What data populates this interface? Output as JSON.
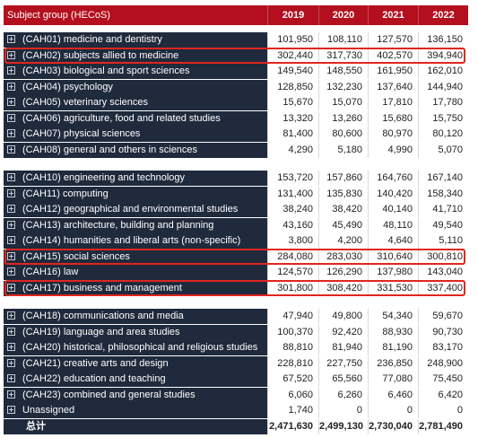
{
  "header": {
    "label": "Subject group (HECoS)",
    "years": [
      "2019",
      "2020",
      "2021",
      "2022"
    ]
  },
  "groups": [
    [
      {
        "label": "(CAH01) medicine and dentistry",
        "values": [
          "101,950",
          "108,110",
          "127,570",
          "136,150"
        ]
      },
      {
        "label": "(CAH02) subjects allied to medicine",
        "values": [
          "302,440",
          "317,730",
          "402,570",
          "394,940"
        ]
      },
      {
        "label": "(CAH03) biological and sport sciences",
        "values": [
          "149,540",
          "148,550",
          "161,950",
          "162,010"
        ]
      },
      {
        "label": "(CAH04) psychology",
        "values": [
          "128,850",
          "132,230",
          "137,640",
          "144,940"
        ]
      },
      {
        "label": "(CAH05) veterinary sciences",
        "values": [
          "15,670",
          "15,070",
          "17,810",
          "17,780"
        ]
      },
      {
        "label": "(CAH06) agriculture, food and related studies",
        "values": [
          "13,320",
          "13,260",
          "15,680",
          "15,750"
        ]
      },
      {
        "label": "(CAH07) physical sciences",
        "values": [
          "81,400",
          "80,600",
          "80,970",
          "80,120"
        ]
      },
      {
        "label": "(CAH08) general and others in sciences",
        "values": [
          "4,290",
          "5,180",
          "4,990",
          "5,070"
        ]
      }
    ],
    [
      {
        "label": "(CAH10) engineering and technology",
        "values": [
          "153,720",
          "157,860",
          "164,760",
          "167,140"
        ]
      },
      {
        "label": "(CAH11) computing",
        "values": [
          "131,400",
          "135,830",
          "140,420",
          "158,340"
        ]
      },
      {
        "label": "(CAH12) geographical and environmental studies",
        "values": [
          "38,240",
          "38,420",
          "40,140",
          "41,710"
        ]
      },
      {
        "label": "(CAH13) architecture, building and planning",
        "values": [
          "43,160",
          "45,490",
          "48,110",
          "49,540"
        ]
      },
      {
        "label": "(CAH14) humanities and liberal arts (non-specific)",
        "values": [
          "3,800",
          "4,200",
          "4,640",
          "5,110"
        ]
      },
      {
        "label": "(CAH15) social sciences",
        "values": [
          "284,080",
          "283,030",
          "310,640",
          "300,810"
        ]
      },
      {
        "label": "(CAH16) law",
        "values": [
          "124,570",
          "126,290",
          "137,980",
          "143,040"
        ]
      },
      {
        "label": "(CAH17) business and management",
        "values": [
          "301,800",
          "308,420",
          "331,530",
          "337,400"
        ]
      }
    ],
    [
      {
        "label": "(CAH18) communications and media",
        "values": [
          "47,940",
          "49,800",
          "54,340",
          "59,670"
        ]
      },
      {
        "label": "(CAH19) language and area studies",
        "values": [
          "100,370",
          "92,420",
          "88,930",
          "90,730"
        ]
      },
      {
        "label": "(CAH20) historical, philosophical and religious studies",
        "values": [
          "88,810",
          "81,940",
          "81,190",
          "83,170"
        ]
      },
      {
        "label": "(CAH21) creative arts and design",
        "values": [
          "228,810",
          "227,750",
          "236,850",
          "248,900"
        ]
      },
      {
        "label": "(CAH22) education and teaching",
        "values": [
          "67,520",
          "65,560",
          "77,080",
          "75,450"
        ]
      },
      {
        "label": "(CAH23) combined and general studies",
        "values": [
          "6,060",
          "6,260",
          "6,460",
          "6,420"
        ]
      },
      {
        "label": "Unassigned",
        "values": [
          "1,740",
          "0",
          "0",
          "0"
        ]
      }
    ]
  ],
  "total": {
    "label": "总计",
    "values": [
      "2,471,630",
      "2,499,130",
      "2,730,040",
      "2,781,490"
    ]
  },
  "highlighted": [
    "(CAH02) subjects allied to medicine",
    "(CAH15) social sciences",
    "(CAH17) business and management"
  ],
  "colors": {
    "header_bg": "#b40f1e",
    "row_label_bg": "#1f2a3c",
    "highlight_border": "#e0261f"
  }
}
